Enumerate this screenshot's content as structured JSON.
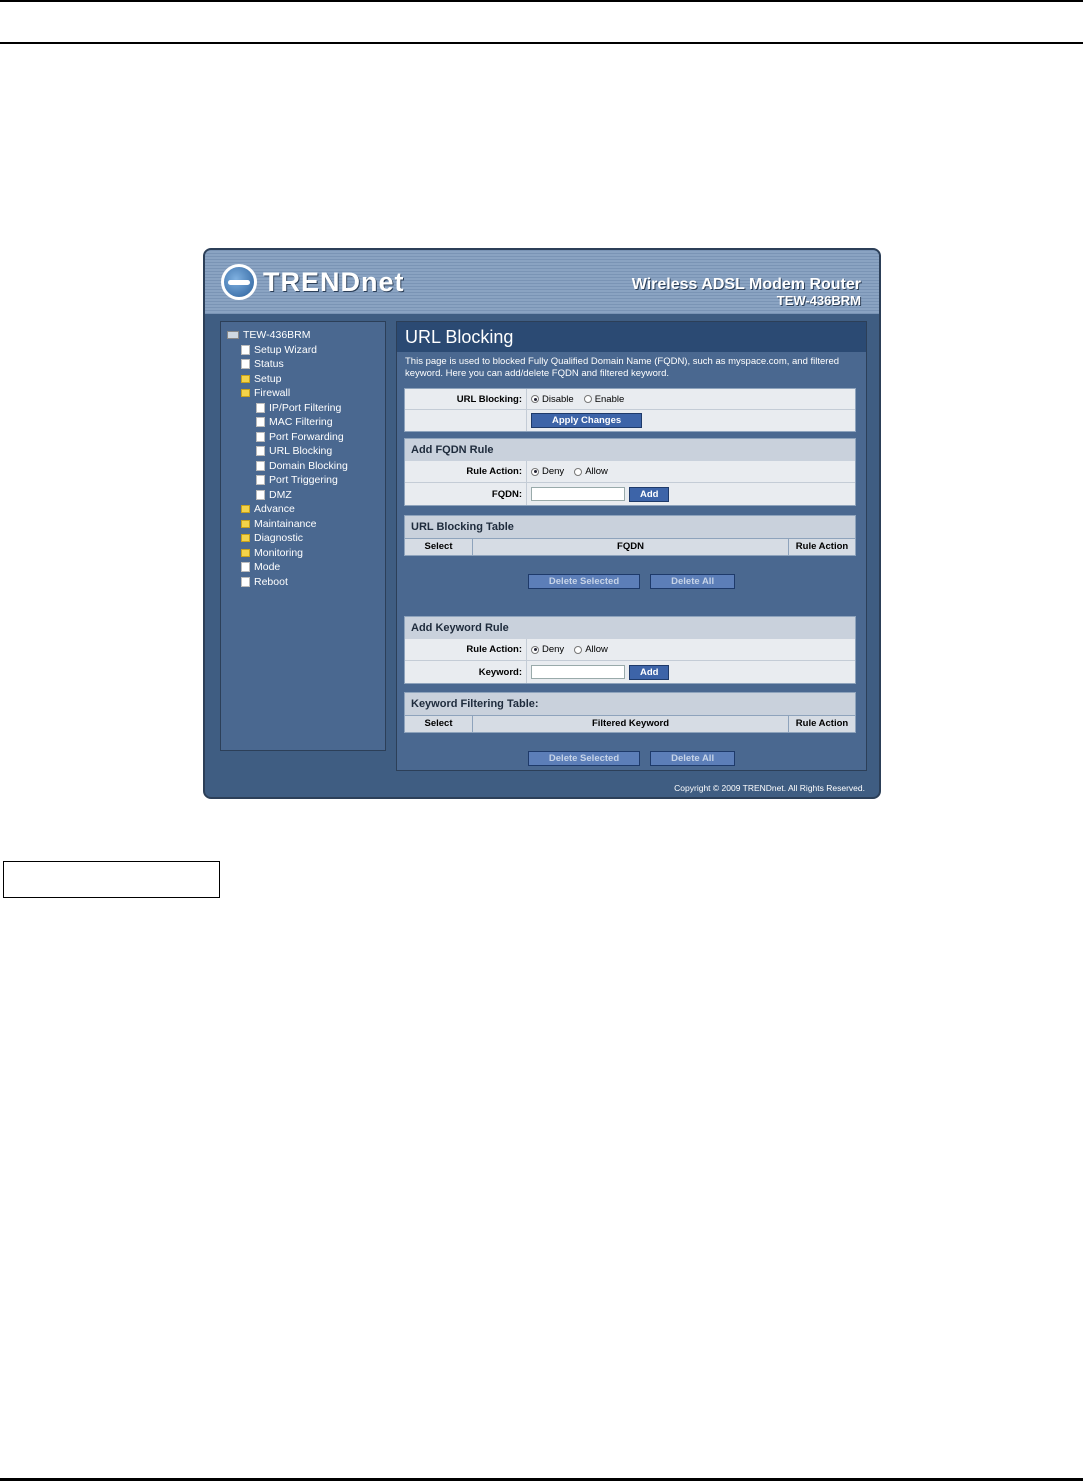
{
  "brand": {
    "logo_text": "TRENDnet",
    "product": "Wireless ADSL Modem Router",
    "model": "TEW-436BRM"
  },
  "sidebar": {
    "root": "TEW-436BRM",
    "items": [
      "Setup Wizard",
      "Status",
      "Setup",
      "Firewall"
    ],
    "firewall_items": [
      "IP/Port Filtering",
      "MAC Filtering",
      "Port Forwarding",
      "URL Blocking",
      "Domain Blocking",
      "Port Triggering",
      "DMZ"
    ],
    "after_items": [
      "Advance",
      "Maintainance",
      "Diagnostic",
      "Monitoring",
      "Mode",
      "Reboot"
    ]
  },
  "page": {
    "title": "URL Blocking",
    "description": "This page is used to blocked Fully Qualified Domain Name (FQDN), such as myspace.com, and filtered keyword. Here you can add/delete FQDN and filtered keyword."
  },
  "url_blocking": {
    "label": "URL Blocking:",
    "disable": "Disable",
    "enable": "Enable",
    "apply": "Apply Changes"
  },
  "fqdn_rule": {
    "title": "Add FQDN Rule",
    "action_label": "Rule Action:",
    "deny": "Deny",
    "allow": "Allow",
    "field_label": "FQDN:",
    "add": "Add"
  },
  "url_table": {
    "title": "URL Blocking Table",
    "columns": [
      "Select",
      "FQDN",
      "Rule Action"
    ],
    "delete_selected": "Delete Selected",
    "delete_all": "Delete All"
  },
  "keyword_rule": {
    "title": "Add Keyword Rule",
    "action_label": "Rule Action:",
    "deny": "Deny",
    "allow": "Allow",
    "field_label": "Keyword:",
    "add": "Add"
  },
  "keyword_table": {
    "title": "Keyword Filtering Table:",
    "columns": [
      "Select",
      "Filtered Keyword",
      "Rule Action"
    ],
    "delete_selected": "Delete Selected",
    "delete_all": "Delete All"
  },
  "footer": {
    "copyright": "Copyright © 2009 TRENDnet. All Rights Reserved."
  }
}
